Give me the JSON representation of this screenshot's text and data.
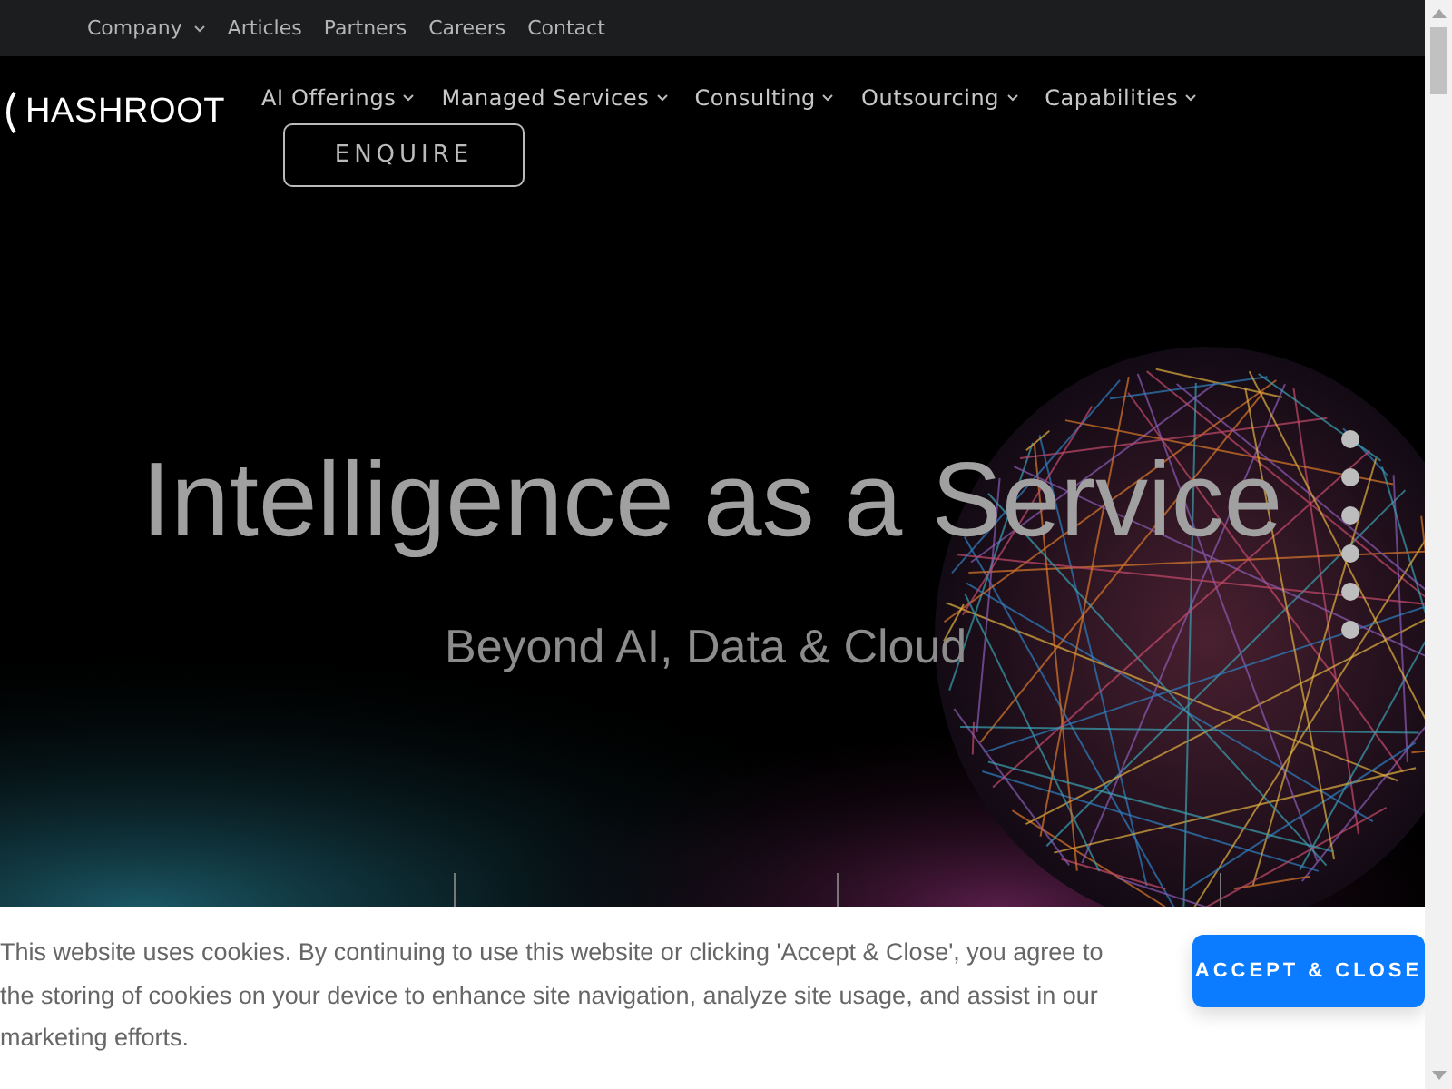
{
  "top_links": [
    {
      "label": "Company",
      "dropdown": true
    },
    {
      "label": "Articles",
      "dropdown": false
    },
    {
      "label": "Partners",
      "dropdown": false
    },
    {
      "label": "Careers",
      "dropdown": false
    },
    {
      "label": "Contact",
      "dropdown": false
    }
  ],
  "logo": {
    "text": "HASHROOT"
  },
  "nav": [
    {
      "label": "AI Offerings",
      "dropdown": true
    },
    {
      "label": "Managed Services",
      "dropdown": true
    },
    {
      "label": "Consulting",
      "dropdown": true
    },
    {
      "label": "Outsourcing",
      "dropdown": true
    },
    {
      "label": "Capabilities",
      "dropdown": true
    }
  ],
  "enquire": "ENQUIRE",
  "hero": {
    "title": "Intelligence as a Service",
    "subtitle": "Beyond AI, Data & Cloud"
  },
  "cookie": {
    "text": "This website uses cookies. By continuing to use this website or clicking 'Accept & Close', you agree to the storing of cookies on your device to enhance site navigation, analyze site usage, and assist in our marketing efforts.",
    "button": "ACCEPT & CLOSE"
  }
}
